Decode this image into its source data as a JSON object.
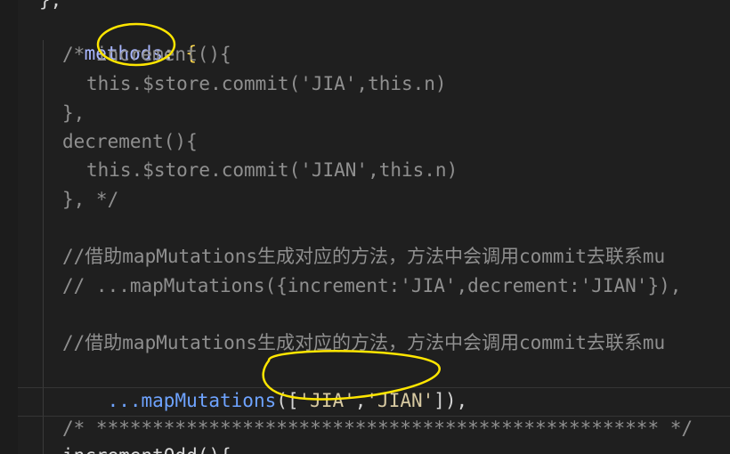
{
  "lines": [
    "};",
    "methods: {",
    "/* increment(){",
    "this.$store.commit('JIA',this.n)",
    "},",
    "decrement(){",
    "this.$store.commit('JIAN',this.n)",
    "}, */",
    "//借助mapMutations生成对应的方法，方法中会调用commit去联系mu",
    "// ...mapMutations({increment:'JIA',decrement:'JIAN'}),",
    "//借助mapMutations生成对应的方法，方法中会调用commit去联系mu",
    "...mapMutations(['JIA','JIAN']),",
    "/* ************************************************** */",
    "incrementOdd(){"
  ],
  "colors": {
    "background": "#1f1f1f",
    "comment": "#8f8f8f",
    "property": "#a9b7ff",
    "string": "#d7c9a1",
    "function": "#6ea3ff",
    "annotation": "#ffe600"
  }
}
